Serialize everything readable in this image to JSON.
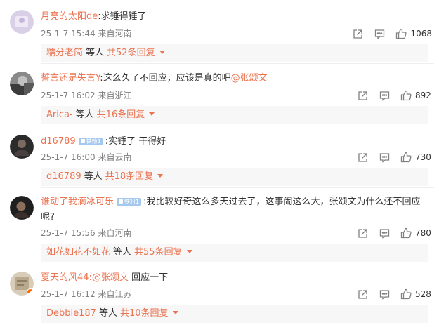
{
  "comments": [
    {
      "username": "月亮的太阳de",
      "has_badge": false,
      "text": ":求锤得锤了",
      "mention": "",
      "time": "25-1-7 15:44",
      "location": "来自河南",
      "likes": "1068",
      "reply_user": "糯分老简",
      "reply_etc": "等人",
      "reply_count": "共52条回复"
    },
    {
      "username": "誓言还是失言Y",
      "has_badge": false,
      "text": ":这么久了不回应，应该是真的吧",
      "mention": "@张颂文",
      "time": "25-1-7 16:02",
      "location": "来自浙江",
      "likes": "892",
      "reply_user": "Arica-",
      "reply_etc": "等人",
      "reply_count": "共16条回复"
    },
    {
      "username": "d16789",
      "has_badge": true,
      "badge": "铁粉1",
      "text": ":实锤了 干得好",
      "mention": "",
      "time": "25-1-7 16:00",
      "location": "来自云南",
      "likes": "730",
      "reply_user": "d16789",
      "reply_etc": "等人",
      "reply_count": "共18条回复"
    },
    {
      "username": "谁动了我滴冰可乐",
      "has_badge": true,
      "badge": "铁粉1",
      "text": ":我比较好奇这么多天过去了，这事闹这么大，张颂文为什么还不回应呢?",
      "mention": "",
      "time": "25-1-7 15:56",
      "location": "来自河南",
      "likes": "780",
      "reply_user": "如花如花不如花",
      "reply_etc": "等人",
      "reply_count": "共55条回复"
    },
    {
      "username": "夏天的风44",
      "has_badge": false,
      "text": " 回应一下",
      "mention": ":@张颂文",
      "time": "25-1-7 16:12",
      "location": "来自江苏",
      "likes": "528",
      "reply_user": "Debbie187",
      "reply_etc": "等人",
      "reply_count": "共10条回复"
    }
  ],
  "colors": {
    "accent": "#eb7350",
    "meta": "#808080",
    "reply_bg": "#f7f7f7",
    "badge": "#a5c8ef"
  },
  "icons": [
    "share-icon",
    "comment-icon",
    "like-icon",
    "caret-down-icon"
  ]
}
